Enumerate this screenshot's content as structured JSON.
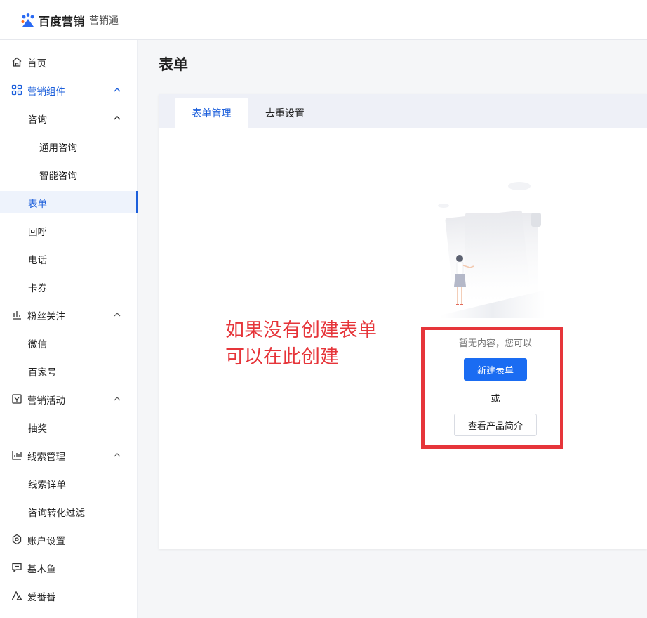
{
  "header": {
    "brand": "百度营销",
    "product": "营销通"
  },
  "sidebar": {
    "items": [
      {
        "label": "首页",
        "icon": "home-icon"
      },
      {
        "label": "营销组件",
        "icon": "grid-icon"
      },
      {
        "label": "咨询"
      },
      {
        "label": "通用咨询"
      },
      {
        "label": "智能咨询"
      },
      {
        "label": "表单"
      },
      {
        "label": "回呼"
      },
      {
        "label": "电话"
      },
      {
        "label": "卡券"
      },
      {
        "label": "粉丝关注",
        "icon": "bar-chart-icon"
      },
      {
        "label": "微信"
      },
      {
        "label": "百家号"
      },
      {
        "label": "营销活动",
        "icon": "activity-icon"
      },
      {
        "label": "抽奖"
      },
      {
        "label": "线索管理",
        "icon": "stats-icon"
      },
      {
        "label": "线索详单"
      },
      {
        "label": "咨询转化过滤"
      },
      {
        "label": "账户设置",
        "icon": "settings-hexagon-icon"
      },
      {
        "label": "基木鱼",
        "icon": "chat-icon"
      },
      {
        "label": "爱番番",
        "icon": "triangle-logo-icon"
      }
    ]
  },
  "main": {
    "title": "表单",
    "tabs": [
      {
        "label": "表单管理"
      },
      {
        "label": "去重设置"
      }
    ],
    "empty": {
      "message": "暂无内容，您可以",
      "create_button": "新建表单",
      "or": "或",
      "intro_button": "查看产品简介"
    }
  },
  "annotation": {
    "line1": "如果没有创建表单",
    "line2": "可以在此创建"
  },
  "colors": {
    "accent": "#1c5fdb",
    "primary_button": "#1a6cf2",
    "annotation_red": "#e6353a"
  }
}
